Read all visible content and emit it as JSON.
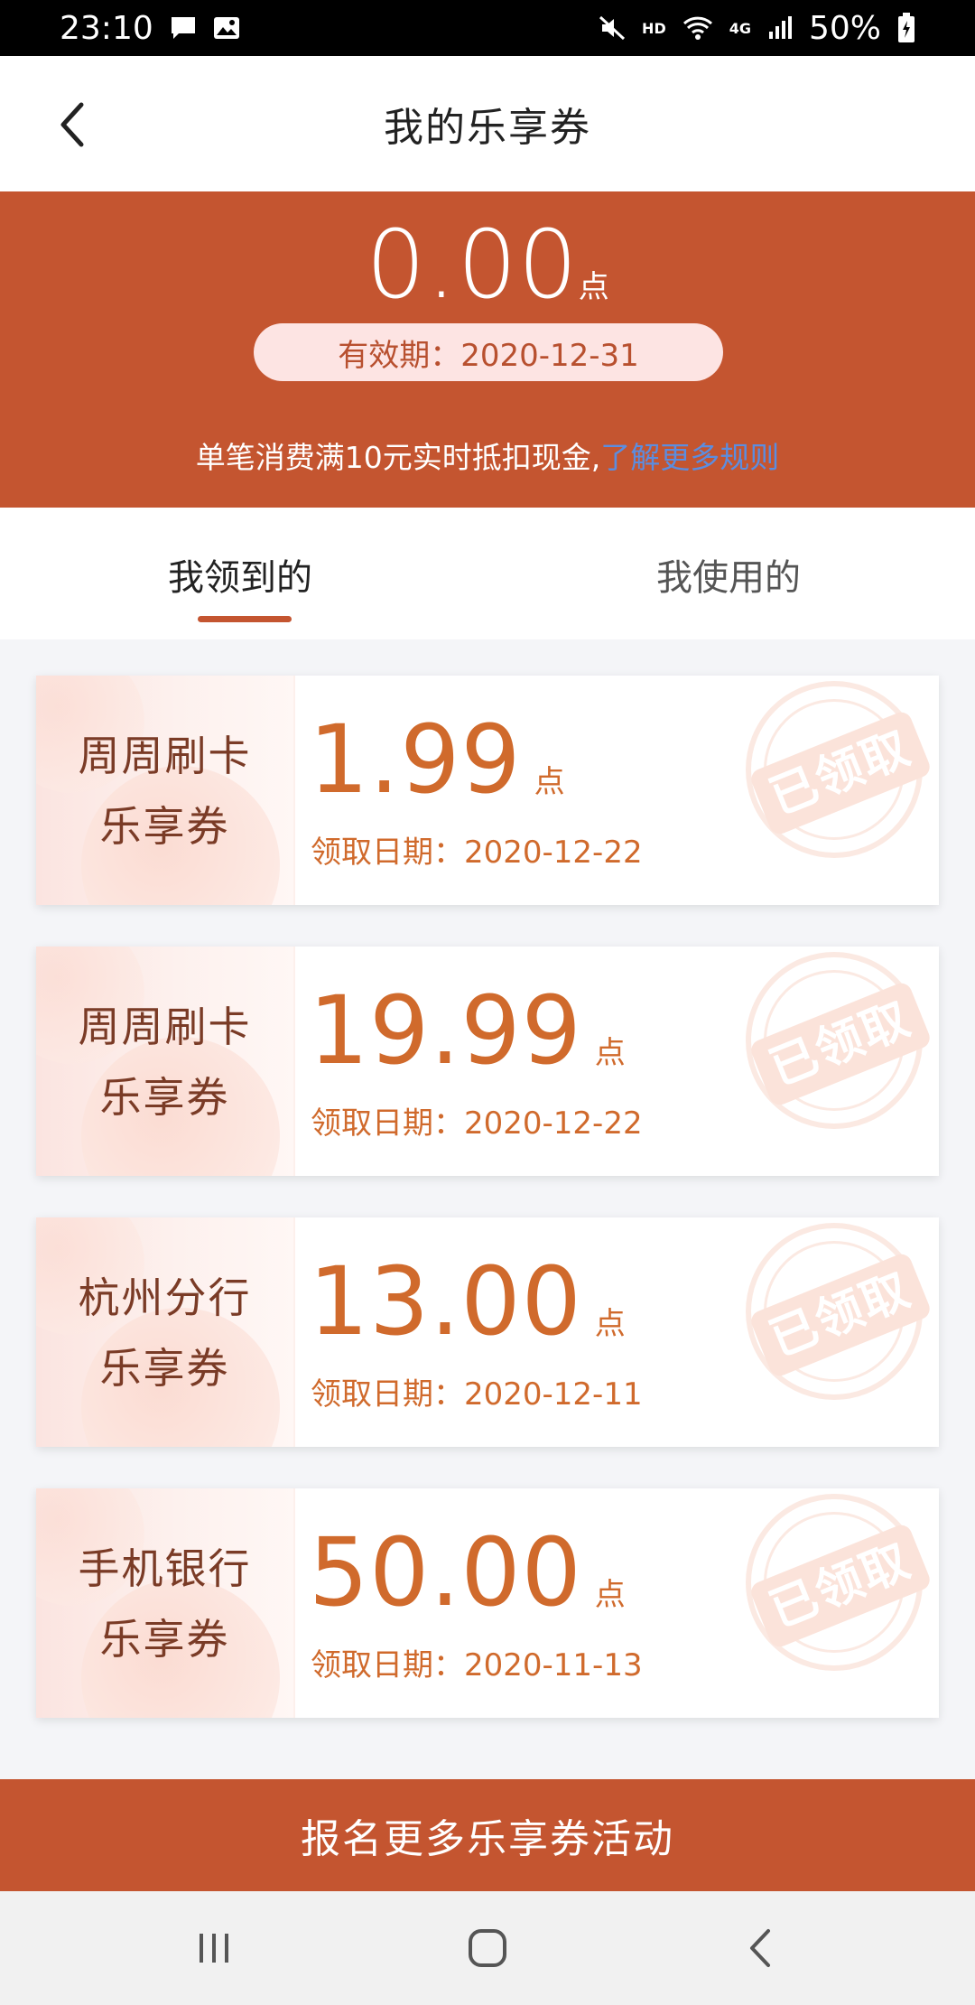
{
  "status_bar": {
    "time": "23:10",
    "hd": "HD",
    "network": "4G",
    "battery": "50%",
    "icons": [
      "message-icon",
      "image-icon",
      "mute-icon",
      "wifi-icon",
      "signal-icon",
      "battery-icon"
    ]
  },
  "header": {
    "title": "我的乐享券",
    "back_icon": "chevron-left-icon"
  },
  "banner": {
    "balance": "0.00",
    "unit": "点",
    "validity": "有效期：2020-12-31",
    "rule_text": "单笔消费满10元实时抵扣现金,",
    "rule_link": "了解更多规则",
    "background_color": "#c45530",
    "link_color": "#5b8de0"
  },
  "tabs": {
    "received": "我领到的",
    "used": "我使用的",
    "active": "received"
  },
  "coupons": [
    {
      "name_line1": "周周刷卡",
      "name_line2": "乐享券",
      "amount": "1.99",
      "unit": "点",
      "date": "领取日期：2020-12-22",
      "stamp": "已领取"
    },
    {
      "name_line1": "周周刷卡",
      "name_line2": "乐享券",
      "amount": "19.99",
      "unit": "点",
      "date": "领取日期：2020-12-22",
      "stamp": "已领取"
    },
    {
      "name_line1": "杭州分行",
      "name_line2": "乐享券",
      "amount": "13.00",
      "unit": "点",
      "date": "领取日期：2020-12-11",
      "stamp": "已领取"
    },
    {
      "name_line1": "手机银行",
      "name_line2": "乐享券",
      "amount": "50.00",
      "unit": "点",
      "date": "领取日期：2020-11-13",
      "stamp": "已领取"
    }
  ],
  "bottom_action": {
    "label": "报名更多乐享券活动"
  },
  "nav_bar": {
    "icons": [
      "recents-icon",
      "home-icon",
      "back-icon"
    ]
  }
}
